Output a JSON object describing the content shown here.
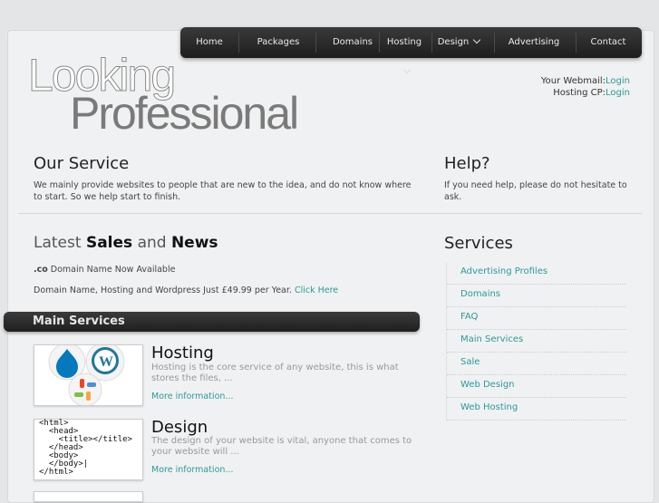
{
  "nav": {
    "items": [
      "Home",
      "Packages",
      "Domains",
      "Hosting",
      "Design",
      "Advertising",
      "Contact"
    ]
  },
  "logo": {
    "line1": "Looking",
    "line2": "Professional"
  },
  "login": {
    "webmail_label": "Your Webmail:",
    "webmail_link": "Login",
    "hosting_label": "Hosting CP:",
    "hosting_link": "Login"
  },
  "our_service": {
    "title": "Our Service",
    "text": "We mainly provide websites to people that are new to the idea, and do not know where to start. So we help start to finish."
  },
  "help": {
    "title": "Help?",
    "text": "If you need help, please do not hesitate to ask."
  },
  "latest": {
    "w1": "Latest",
    "w2": "Sales",
    "w3": "and",
    "w4": "News",
    "item1_bold": ".co",
    "item1_text": " Domain Name Now Available",
    "item2_text": "Domain Name, Hosting and Wordpress Just £49.99 per Year.",
    "item2_link": "Click Here"
  },
  "main_services": {
    "title": "Main Services"
  },
  "services": {
    "title": "Services",
    "items": [
      "Advertising Profiles",
      "Domains",
      "FAQ",
      "Main Services",
      "Sale",
      "Web Design",
      "Web Hosting"
    ]
  },
  "hosting": {
    "title": "Hosting",
    "text": "Hosting is the core service of any website, this is what stores the files, ...",
    "more": "More information..."
  },
  "design": {
    "title": "Design",
    "text": "The design of your website is vital, anyone that comes to your website will ...",
    "more": "More information..."
  },
  "colors": {
    "accent": "#2a9a9a",
    "nav_bg": "#2a2a2a"
  }
}
